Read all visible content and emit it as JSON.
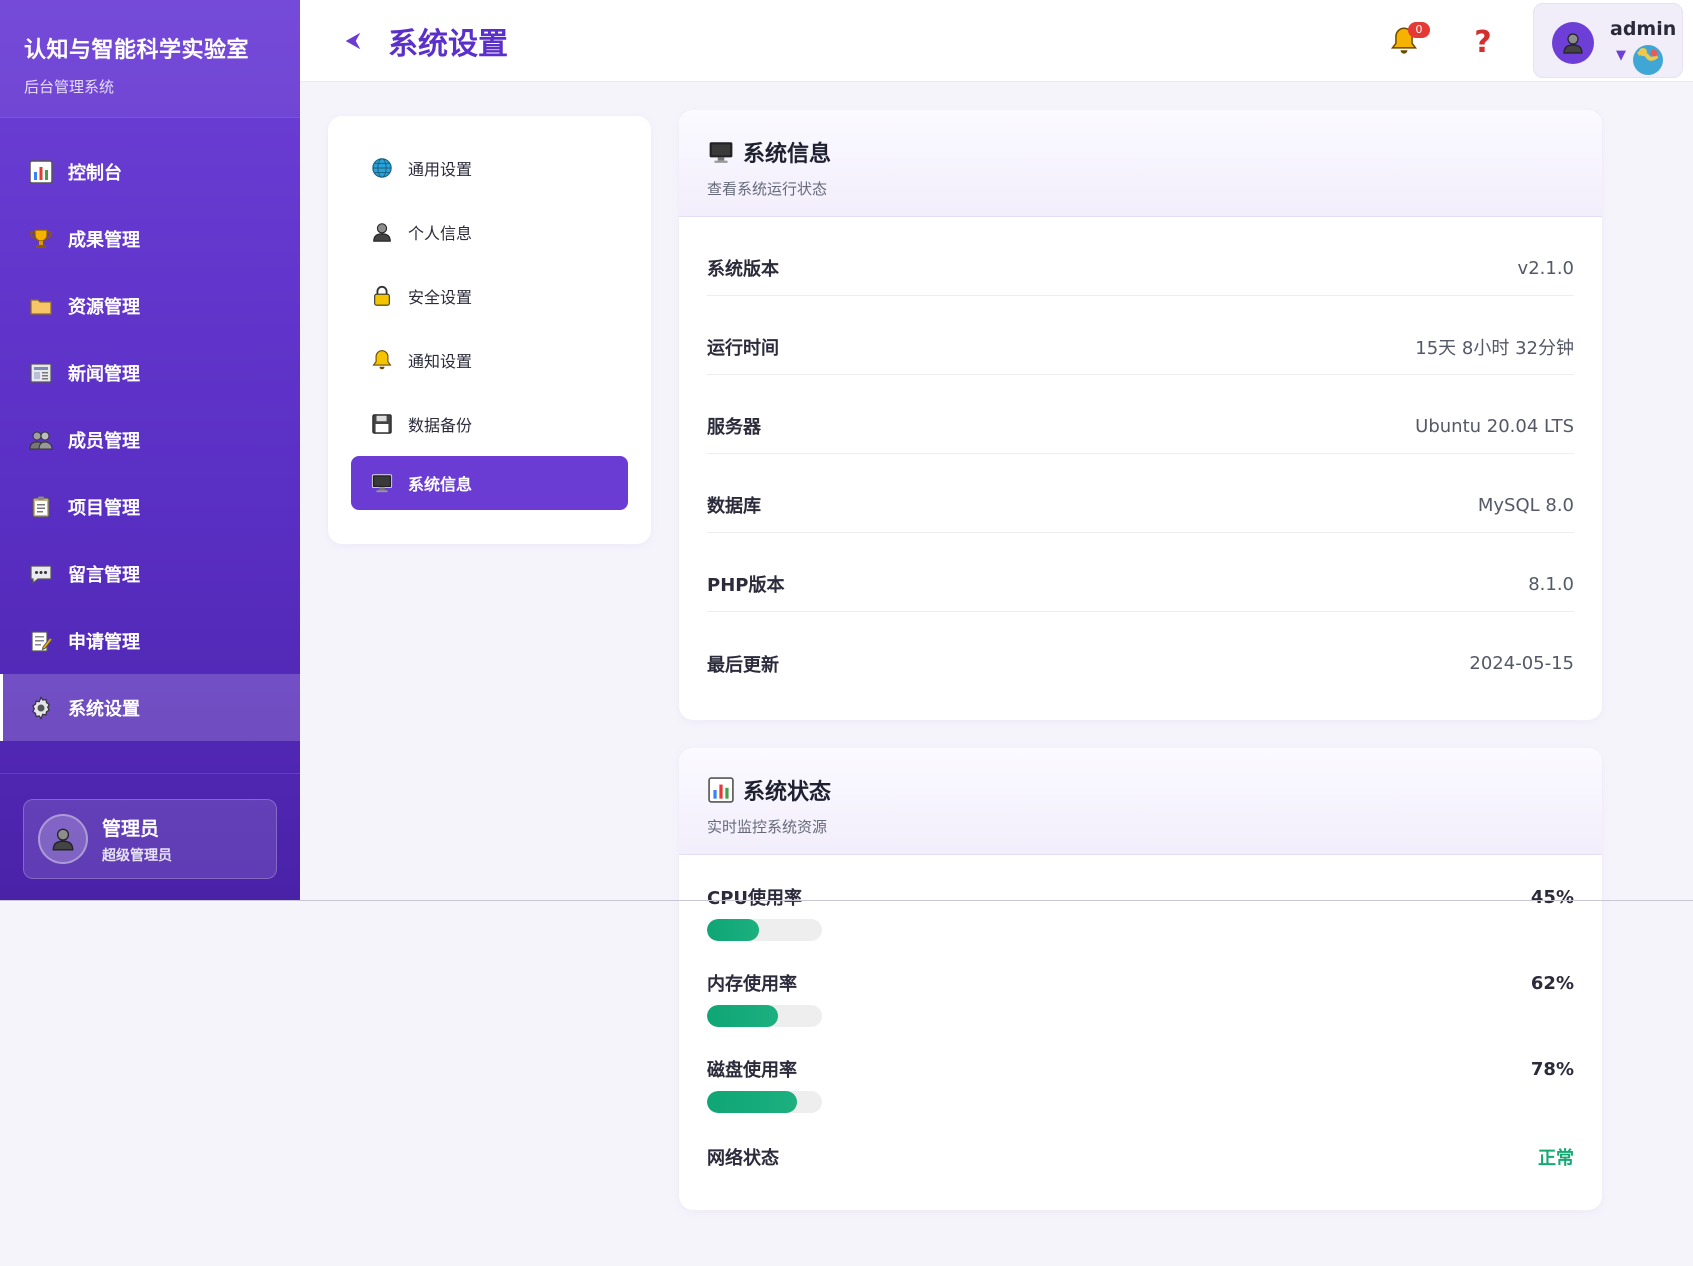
{
  "brand": {
    "title": "认知与智能科学实验室",
    "subtitle": "后台管理系统"
  },
  "nav": [
    {
      "label": "控制台",
      "icon": "chart-icon"
    },
    {
      "label": "成果管理",
      "icon": "trophy-icon"
    },
    {
      "label": "资源管理",
      "icon": "folder-icon"
    },
    {
      "label": "新闻管理",
      "icon": "newspaper-icon"
    },
    {
      "label": "成员管理",
      "icon": "users-icon"
    },
    {
      "label": "项目管理",
      "icon": "clipboard-icon"
    },
    {
      "label": "留言管理",
      "icon": "message-icon"
    },
    {
      "label": "申请管理",
      "icon": "edit-icon"
    },
    {
      "label": "系统设置",
      "icon": "gear-icon",
      "active": true
    }
  ],
  "sidebar_user": {
    "name": "管理员",
    "role": "超级管理员"
  },
  "header": {
    "title": "系统设置",
    "notification_count": "0",
    "help": "?",
    "username": "admin",
    "caret": "▼"
  },
  "settings_menu": [
    {
      "label": "通用设置",
      "icon": "globe-icon"
    },
    {
      "label": "个人信息",
      "icon": "person-icon"
    },
    {
      "label": "安全设置",
      "icon": "lock-icon"
    },
    {
      "label": "通知设置",
      "icon": "bell-icon"
    },
    {
      "label": "数据备份",
      "icon": "floppy-icon"
    },
    {
      "label": "系统信息",
      "icon": "monitor-icon",
      "active": true
    }
  ],
  "system_info": {
    "title": "系统信息",
    "subtitle": "查看系统运行状态",
    "rows": [
      {
        "key": "系统版本",
        "value": "v2.1.0"
      },
      {
        "key": "运行时间",
        "value": "15天 8小时 32分钟"
      },
      {
        "key": "服务器",
        "value": "Ubuntu 20.04 LTS"
      },
      {
        "key": "数据库",
        "value": "MySQL 8.0"
      },
      {
        "key": "PHP版本",
        "value": "8.1.0"
      },
      {
        "key": "最后更新",
        "value": "2024-05-15"
      }
    ]
  },
  "system_status": {
    "title": "系统状态",
    "subtitle": "实时监控系统资源",
    "cpu": {
      "label": "CPU使用率",
      "value": "45%",
      "percent": 45
    },
    "memory": {
      "label": "内存使用率",
      "value": "62%",
      "percent": 62
    },
    "disk": {
      "label": "磁盘使用率",
      "value": "78%",
      "percent": 78
    },
    "network": {
      "label": "网络状态",
      "value": "正常",
      "color": "#17a974"
    }
  },
  "colors": {
    "primary": "#6a3cd4",
    "accent_green": "#12a877",
    "badge_red": "#e53935"
  }
}
